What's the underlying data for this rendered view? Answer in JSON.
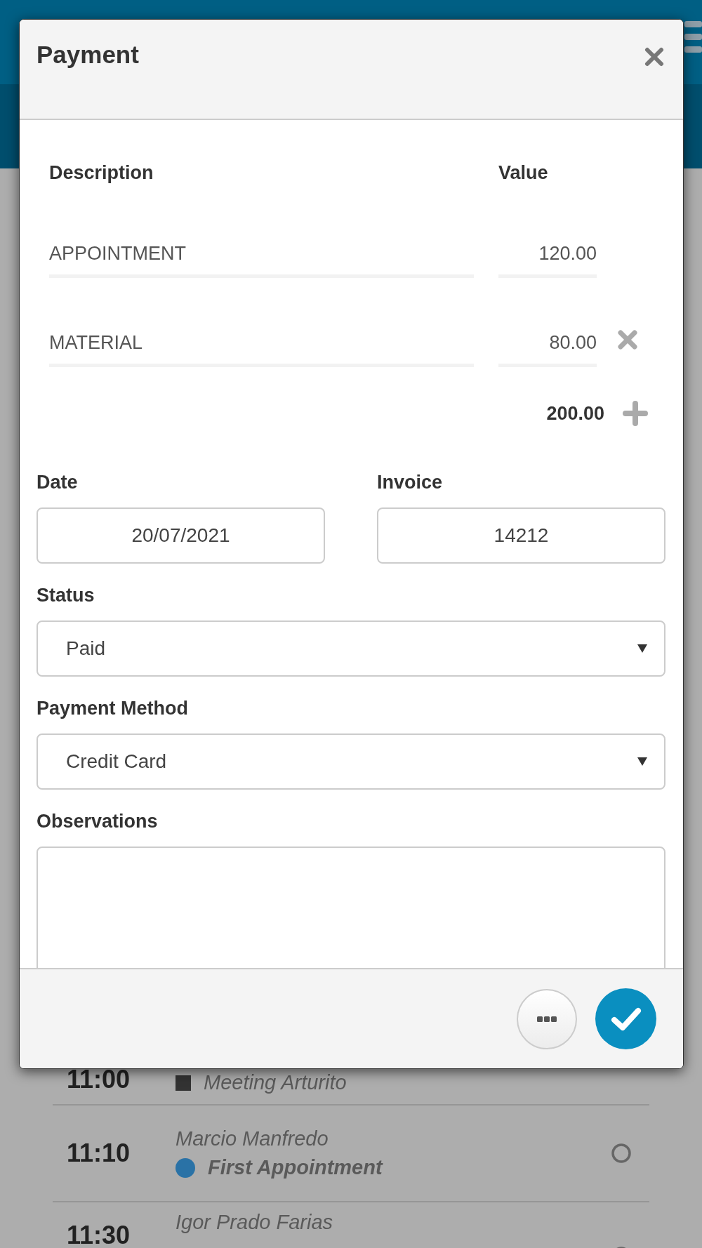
{
  "schedule": [
    {
      "time": "11:00",
      "event": "Meeting Arturito",
      "kind": "meeting",
      "color": "#333333"
    },
    {
      "time": "11:10",
      "patient": "Marcio Manfredo",
      "event": "First Appointment",
      "kind": "appointment",
      "color": "#2a72a6"
    },
    {
      "time": "11:30",
      "patient": "Igor Prado Farias"
    }
  ],
  "dialog": {
    "title": "Payment",
    "columns": [
      "Description",
      "Value"
    ],
    "items": [
      {
        "description": "APPOINTMENT",
        "value": "120.00",
        "removable": false
      },
      {
        "description": "MATERIAL",
        "value": "80.00",
        "removable": true
      }
    ],
    "total": "200.00",
    "fields": [
      {
        "kind": "text",
        "label": "Date",
        "value": "20/07/2021"
      },
      {
        "kind": "text",
        "label": "Invoice",
        "value": "14212"
      },
      {
        "kind": "select",
        "label": "Status",
        "value": "Paid"
      },
      {
        "kind": "select",
        "label": "Payment Method",
        "value": "Credit Card"
      },
      {
        "kind": "textarea",
        "label": "Observations"
      }
    ]
  }
}
